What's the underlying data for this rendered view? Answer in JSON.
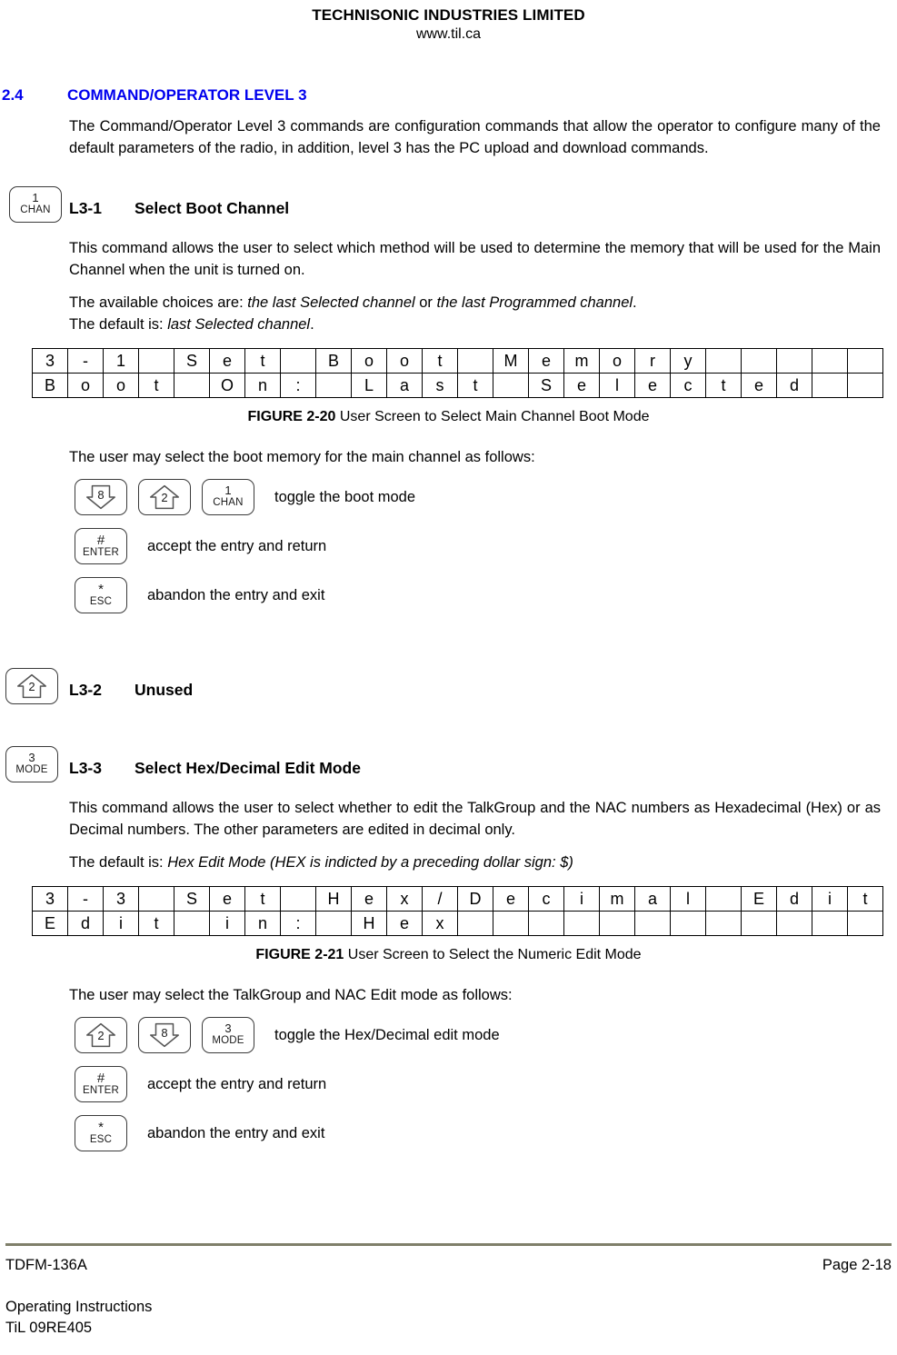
{
  "header": {
    "company": "TECHNISONIC INDUSTRIES LIMITED",
    "website": "www.til.ca"
  },
  "section": {
    "number": "2.4",
    "title": "COMMAND/OPERATOR LEVEL 3",
    "accent_color": "#0000ee",
    "intro": "The Command/Operator Level 3 commands are configuration commands that allow the operator to configure many of the default parameters of the radio, in addition, level 3 has the PC upload and download commands."
  },
  "commands": [
    {
      "id": "L3-1",
      "title": "Select Boot Channel",
      "key": {
        "top": "1",
        "bottom": "CHAN",
        "style": "text"
      },
      "paragraphs": [
        "This command allows the user to select which method will be used to determine the memory that will be used for the Main Channel when the unit is turned on."
      ],
      "choices_prefix": "The available choices are: ",
      "choices_italic_1": "the last Selected channel",
      "choices_mid": " or ",
      "choices_italic_2": "the last Programmed channel",
      "choices_suffix": ".",
      "default_prefix": "The default is: ",
      "default_italic": "last Selected channel",
      "default_suffix": "."
    },
    {
      "id": "L3-2",
      "title": "Unused",
      "key": {
        "top": "2",
        "bottom": "",
        "style": "up-arrow"
      }
    },
    {
      "id": "L3-3",
      "title": "Select Hex/Decimal Edit Mode",
      "key": {
        "top": "3",
        "bottom": "MODE",
        "style": "text"
      },
      "paragraphs": [
        "This command allows the user to select whether to edit the TalkGroup and the NAC numbers as Hexadecimal (Hex) or as Decimal numbers. The other parameters are edited in decimal only."
      ],
      "default_prefix": "The default is: ",
      "default_italic": "Hex Edit Mode (HEX is indicted by a preceding dollar sign: $)",
      "default_suffix": ""
    }
  ],
  "figures": [
    {
      "number": "FIGURE 2-20",
      "caption": " User Screen to Select Main Channel Boot Mode",
      "columns": 24,
      "rows": [
        [
          "3",
          "-",
          "1",
          "",
          "S",
          "e",
          "t",
          "",
          "B",
          "o",
          "o",
          "t",
          "",
          "M",
          "e",
          "m",
          "o",
          "r",
          "y",
          "",
          "",
          "",
          "",
          ""
        ],
        [
          "B",
          "o",
          "o",
          "t",
          "",
          "O",
          "n",
          ":",
          "",
          "L",
          "a",
          "s",
          "t",
          "",
          "S",
          "e",
          "l",
          "e",
          "c",
          "t",
          "e",
          "d",
          "",
          ""
        ]
      ]
    },
    {
      "number": "FIGURE 2-21",
      "caption": " User Screen to Select the Numeric Edit Mode",
      "columns": 24,
      "rows": [
        [
          "3",
          "-",
          "3",
          "",
          "S",
          "e",
          "t",
          "",
          "H",
          "e",
          "x",
          "/",
          "D",
          "e",
          "c",
          "i",
          "m",
          "a",
          "l",
          "",
          "E",
          "d",
          "i",
          "t"
        ],
        [
          "E",
          "d",
          "i",
          "t",
          "",
          "i",
          "n",
          ":",
          "",
          "H",
          "e",
          "x",
          "",
          "",
          "",
          "",
          "",
          "",
          "",
          "",
          "",
          "",
          "",
          ""
        ]
      ]
    }
  ],
  "legends": [
    {
      "intro": "The user may select the boot memory for the main channel as follows:",
      "rows": [
        {
          "keys": [
            {
              "top": "8",
              "bottom": "",
              "style": "down-arrow"
            },
            {
              "top": "2",
              "bottom": "",
              "style": "up-arrow"
            },
            {
              "top": "1",
              "bottom": "CHAN",
              "style": "text"
            }
          ],
          "text": "toggle the boot mode"
        },
        {
          "keys": [
            {
              "top": "#",
              "bottom": "ENTER",
              "style": "text"
            }
          ],
          "text": "accept the entry and return"
        },
        {
          "keys": [
            {
              "top": "*",
              "bottom": "ESC",
              "style": "text"
            }
          ],
          "text": "abandon the entry and exit"
        }
      ]
    },
    {
      "intro": "The user may select the TalkGroup and NAC Edit mode as follows:",
      "rows": [
        {
          "keys": [
            {
              "top": "2",
              "bottom": "",
              "style": "up-arrow"
            },
            {
              "top": "8",
              "bottom": "",
              "style": "down-arrow"
            },
            {
              "top": "3",
              "bottom": "MODE",
              "style": "text"
            }
          ],
          "text": "toggle the Hex/Decimal edit mode"
        },
        {
          "keys": [
            {
              "top": "#",
              "bottom": "ENTER",
              "style": "text"
            }
          ],
          "text": "accept the entry and return"
        },
        {
          "keys": [
            {
              "top": "*",
              "bottom": "ESC",
              "style": "text"
            }
          ],
          "text": "abandon the entry and exit"
        }
      ]
    }
  ],
  "footer": {
    "model": "TDFM-136A",
    "doc_type": "Operating Instructions",
    "revision": "TiL 09RE405",
    "page": "Page 2-18",
    "rule_color": "#7f7f6a"
  }
}
